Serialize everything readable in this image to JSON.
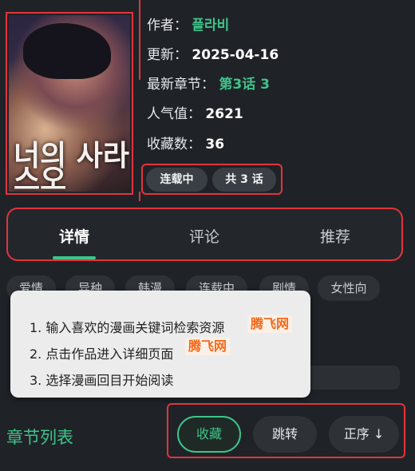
{
  "info": {
    "author_label": "作者：",
    "author_value": "플라비",
    "updated_label": "更新：",
    "updated_value": "2025-04-16",
    "latest_label": "最新章节：",
    "latest_value": "第3话 3",
    "popularity_label": "人气值：",
    "popularity_value": "2621",
    "favorites_label": "收藏数：",
    "favorites_value": "36"
  },
  "cover": {
    "title_text": "너의 사라스오"
  },
  "status_pills": {
    "serializing": "连载中",
    "total": "共 3 话"
  },
  "tabs": [
    "详情",
    "评论",
    "推荐"
  ],
  "tags": [
    "爱情",
    "异种",
    "韩漫",
    "连载中",
    "剧情",
    "女性向"
  ],
  "tooltip": {
    "line1": "1. 输入喜欢的漫画关键词检索资源",
    "line2": "2. 点击作品进入详细页面",
    "line3": "3. 选择漫画回目开始阅读",
    "watermark1": "腾飞网",
    "watermark2": "腾飞网"
  },
  "chapter_list_label": "章节列表",
  "actions": {
    "favorite": "收藏",
    "jump": "跳转",
    "order": "正序 ↓"
  },
  "colors": {
    "accent": "#3ec48a",
    "highlight": "#e3343b",
    "background": "#1f2328"
  }
}
